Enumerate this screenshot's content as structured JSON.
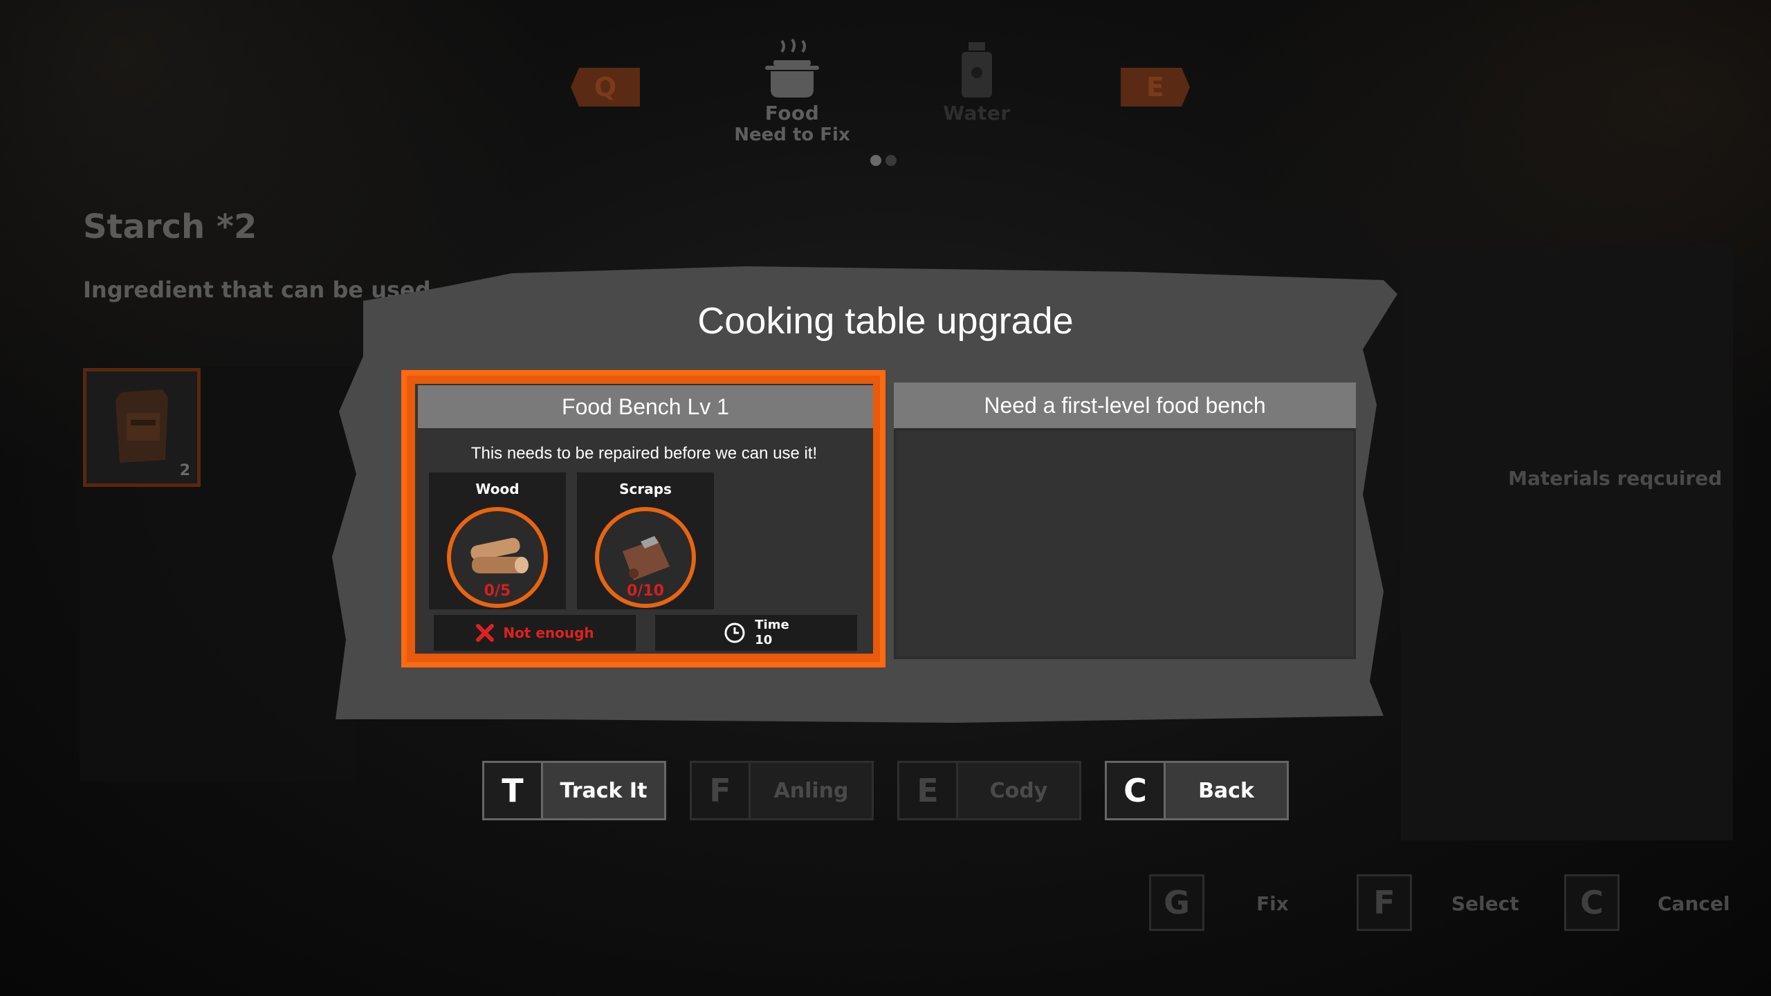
{
  "nav": {
    "prev_key": "Q",
    "next_key": "E",
    "categories": [
      {
        "label": "Food",
        "sub": "Need to Fix",
        "icon": "cooking-pot-icon"
      },
      {
        "label": "Water",
        "sub": "",
        "icon": "water-purifier-icon"
      }
    ],
    "page_dots": 2,
    "active_dot": 0
  },
  "item": {
    "title": "Starch *2",
    "desc": "Ingredient that can be used",
    "slot_count": "2",
    "slot_icon": "starch-bag-icon"
  },
  "materials_required": "Materials reqcuired",
  "dialog": {
    "title": "Cooking table upgrade",
    "left_card": {
      "header": "Food Bench Lv 1",
      "message": "This needs to be repaired before we can use it!",
      "materials": [
        {
          "name": "Wood",
          "qty": "0/5",
          "icon": "wood-logs-icon"
        },
        {
          "name": "Scraps",
          "qty": "0/10",
          "icon": "scraps-icon"
        }
      ],
      "status": {
        "text": "Not enough",
        "icon": "x-icon"
      },
      "time": {
        "label": "Time",
        "value": "10",
        "icon": "clock-icon"
      }
    },
    "right_card": {
      "header": "Need a first-level food bench"
    }
  },
  "actions": [
    {
      "key": "T",
      "label": "Track It",
      "enabled": true
    },
    {
      "key": "F",
      "label": "Anling",
      "enabled": false
    },
    {
      "key": "E",
      "label": "Cody",
      "enabled": false
    },
    {
      "key": "C",
      "label": "Back",
      "enabled": true
    }
  ],
  "hints": [
    {
      "key": "G",
      "label": "Fix"
    },
    {
      "key": "F",
      "label": "Select"
    },
    {
      "key": "C",
      "label": "Cancel"
    }
  ],
  "colors": {
    "accent": "#ff6a10",
    "alert": "#e02020",
    "header_gray": "#7a7a7a"
  }
}
